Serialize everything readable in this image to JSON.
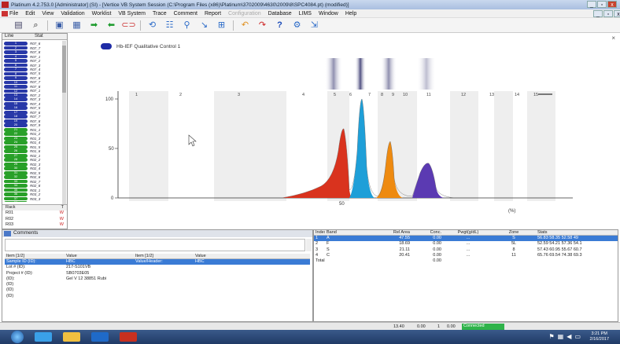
{
  "window": {
    "title": "Platinum 4.2.753.0  [Administrator] (SI) - [Vertice VB System Session (C:\\Program Files (x86)\\Platinum\\3702009\\4630\\2009\\8\\SPC4084.pt) (modified)]",
    "min": "_",
    "max": "▫",
    "close": "x"
  },
  "menu": {
    "items": [
      "File",
      "Edit",
      "View",
      "Validation",
      "Worklist",
      "VB System",
      "Trace",
      "Comment",
      "Report"
    ],
    "disabled_item": "Configuration",
    "items_after": [
      "Database",
      "LIMS",
      "Window",
      "Help"
    ]
  },
  "toolbar": {
    "icons": [
      "print-icon",
      "search-icon",
      "save-icon",
      "move-icon",
      "arrow-right-icon",
      "arrow-left-icon",
      "link-icon",
      "refresh-icon",
      "list-icon",
      "zoom-icon",
      "tool-icon",
      "select-icon",
      "undo-icon",
      "redo-icon",
      "help-icon",
      "settings-icon"
    ]
  },
  "left_panel": {
    "col1": "Line",
    "col2": "Stat",
    "lanes": [
      {
        "num": "1",
        "label": "R07_6",
        "color": "blue"
      },
      {
        "num": "2",
        "label": "R07_7",
        "color": "blue"
      },
      {
        "num": "3",
        "label": "R07_8",
        "color": "blue"
      },
      {
        "num": "4",
        "label": "R07_1",
        "color": "blue"
      },
      {
        "num": "5",
        "label": "R07_2",
        "color": "blue"
      },
      {
        "num": "6",
        "label": "R07_3",
        "color": "blue"
      },
      {
        "num": "7",
        "label": "R07_4",
        "color": "blue"
      },
      {
        "num": "8",
        "label": "R07_5",
        "color": "blue"
      },
      {
        "num": "9",
        "label": "R07_6",
        "color": "blue"
      },
      {
        "num": "10",
        "label": "R07_7",
        "color": "blue"
      },
      {
        "num": "11",
        "label": "R07_8",
        "color": "blue"
      },
      {
        "num": "12",
        "label": "R07_1",
        "color": "blue"
      },
      {
        "num": "13",
        "label": "R07_2",
        "color": "blue"
      },
      {
        "num": "14",
        "label": "R07_3",
        "color": "blue"
      },
      {
        "num": "15",
        "label": "R07_4",
        "color": "blue"
      },
      {
        "num": "16",
        "label": "R07_5",
        "color": "blue"
      },
      {
        "num": "17",
        "label": "R07_6",
        "color": "blue"
      },
      {
        "num": "18",
        "label": "R07_7",
        "color": "blue"
      },
      {
        "num": "19",
        "label": "R07_8",
        "color": "blue"
      },
      {
        "num": "20",
        "label": "R07_9",
        "color": "blue"
      },
      {
        "num": "21",
        "label": "R01_1",
        "color": "green"
      },
      {
        "num": "22",
        "label": "R01_2",
        "color": "green"
      },
      {
        "num": "23",
        "label": "R01_3",
        "color": "green"
      },
      {
        "num": "24",
        "label": "R01_4",
        "color": "green"
      },
      {
        "num": "25",
        "label": "R01_5",
        "color": "green"
      },
      {
        "num": "26",
        "label": "R01_6",
        "color": "green"
      },
      {
        "num": "27",
        "label": "R02_1",
        "color": "green"
      },
      {
        "num": "28",
        "label": "R02_2",
        "color": "green"
      },
      {
        "num": "29",
        "label": "R02_3",
        "color": "green"
      },
      {
        "num": "30",
        "label": "R02_4",
        "color": "green"
      },
      {
        "num": "31",
        "label": "R02_5",
        "color": "green"
      },
      {
        "num": "32",
        "label": "R02_6",
        "color": "green"
      },
      {
        "num": "33",
        "label": "R02_7",
        "color": "green"
      },
      {
        "num": "34",
        "label": "R02_8",
        "color": "green"
      },
      {
        "num": "35",
        "label": "R03_1",
        "color": "green"
      },
      {
        "num": "36",
        "label": "R03_2",
        "color": "green"
      },
      {
        "num": "37",
        "label": "R03_3",
        "color": "green"
      },
      {
        "num": "38",
        "label": "R03_4",
        "color": "green"
      }
    ],
    "rack_header": "Rack",
    "rack_header2": "T",
    "racks": [
      {
        "name": "R01",
        "val": "W"
      },
      {
        "name": "R02",
        "val": "W"
      },
      {
        "name": "R03",
        "val": "W"
      }
    ]
  },
  "plot": {
    "legend_label": "Hb-IEF Qualitative Control 1",
    "y_ticks": [
      "100",
      "50",
      "0"
    ],
    "x_ticks": [
      "50",
      "(%)"
    ],
    "band_labels": [
      "1",
      "2",
      "3",
      "4",
      "5",
      "6",
      "7",
      "8",
      "9",
      "10",
      "11",
      "12",
      "13",
      "14",
      "15"
    ],
    "close": "×"
  },
  "comments": {
    "title": "Comments",
    "table_headers": [
      "Item [1/2]",
      "Value",
      "Item [1/2]",
      "Value"
    ],
    "rows": [
      {
        "c1": "Sample ID (ID):",
        "c2": "HBC",
        "c3": "Value/Header:",
        "c4": "HBC",
        "sel": true
      },
      {
        "c1": "Lot # (ID):",
        "c2": "217-S101VB",
        "c3": "",
        "c4": "",
        "sel": false
      },
      {
        "c1": "Project # (ID):",
        "c2": "SB0703E05",
        "c3": "",
        "c4": "",
        "sel": false
      },
      {
        "c1": "(ID):",
        "c2": "Gel V 12 38851 Rubi",
        "c3": "",
        "c4": "",
        "sel": false
      },
      {
        "c1": "(ID)",
        "c2": "",
        "c3": "",
        "c4": "",
        "sel": false
      },
      {
        "c1": "(ID)",
        "c2": "",
        "c3": "",
        "c4": "",
        "sel": false
      },
      {
        "c1": "(ID)",
        "c2": "",
        "c3": "",
        "c4": "",
        "sel": false
      }
    ]
  },
  "bands": {
    "headers": [
      "Index",
      "Band",
      "Rel Area",
      "Conc.",
      "Pwgt(g/dL)",
      "Zone",
      "Stats"
    ],
    "rows": [
      {
        "idx": "1",
        "band": "A",
        "rel": "47.55",
        "conc": "0.00",
        "pg": "...",
        "zone": "S",
        "stats": "56.83 58.35 52.58 49",
        "sel": true
      },
      {
        "idx": "2",
        "band": "F",
        "rel": "18.69",
        "conc": "0.00",
        "pg": "...",
        "zone": "5L",
        "stats": "52.59 54.21 57.36 54.1",
        "sel": false
      },
      {
        "idx": "3",
        "band": "S",
        "rel": "21.11",
        "conc": "0.00",
        "pg": "...",
        "zone": "8",
        "stats": "57.43 60.95 55.67 60.7",
        "sel": false
      },
      {
        "idx": "4",
        "band": "C",
        "rel": "20.41",
        "conc": "0.00",
        "pg": "...",
        "zone": "11",
        "stats": "65.76 69.54 74.38 69.3",
        "sel": false
      },
      {
        "idx": "Total",
        "band": "",
        "rel": "",
        "conc": "0.00",
        "pg": "",
        "zone": "",
        "stats": "",
        "sel": false
      }
    ]
  },
  "status": {
    "coord": "13.40",
    "v2": "0.00",
    "v3": "1",
    "v4": "0.00",
    "connection": "Connected"
  },
  "taskbar": {
    "time": "3:21 PM",
    "date": "2/16/2017"
  },
  "colors": {
    "peak_red": "#d9331e",
    "peak_blue": "#1e9fd8",
    "peak_orange": "#ee8a10",
    "peak_purple": "#5b3ab2",
    "lane_blue": "#2838a8",
    "lane_green": "#28a028"
  }
}
